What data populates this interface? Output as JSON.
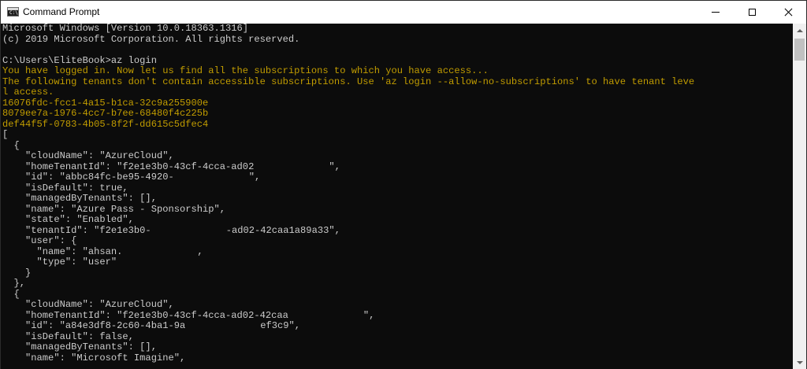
{
  "window": {
    "title": "Command Prompt",
    "icon": "cmd-prompt-icon",
    "controls": {
      "minimize": "minimize-icon",
      "maximize": "maximize-icon",
      "close": "close-icon"
    }
  },
  "colors": {
    "console_background": "#0c0c0c",
    "default_text": "#cccccc",
    "warning_text": "#c19c00"
  },
  "console": {
    "lines": [
      {
        "text": "Microsoft Windows [Version 10.0.18363.1316]",
        "color": "gray"
      },
      {
        "text": "(c) 2019 Microsoft Corporation. All rights reserved.",
        "color": "gray"
      },
      {
        "text": "",
        "color": "gray"
      },
      {
        "text": "C:\\Users\\EliteBook>az login",
        "color": "gray"
      },
      {
        "text": "You have logged in. Now let us find all the subscriptions to which you have access...",
        "color": "yellow"
      },
      {
        "text": "The following tenants don't contain accessible subscriptions. Use 'az login --allow-no-subscriptions' to have tenant leve",
        "color": "yellow"
      },
      {
        "text": "l access.",
        "color": "yellow"
      },
      {
        "text": "16076fdc-fcc1-4a15-b1ca-32c9a255900e",
        "color": "yellow"
      },
      {
        "text": "8079ee7a-1976-4cc7-b7ee-68480f4c225b",
        "color": "yellow"
      },
      {
        "text": "def44f5f-0783-4b05-8f2f-dd615c5dfec4",
        "color": "yellow"
      },
      {
        "text": "[",
        "color": "gray"
      },
      {
        "text": "  {",
        "color": "gray"
      },
      {
        "text": "    \"cloudName\": \"AzureCloud\",",
        "color": "gray"
      },
      {
        "text": "    \"homeTenantId\": \"f2e1e3b0-43cf-4cca-ad02",
        "suffix": "\",",
        "redacted": true,
        "color": "gray"
      },
      {
        "text": "    \"id\": \"abbc84fc-be95-4920-",
        "suffix": "\",",
        "redacted": true,
        "color": "gray"
      },
      {
        "text": "    \"isDefault\": true,",
        "color": "gray"
      },
      {
        "text": "    \"managedByTenants\": [],",
        "color": "gray"
      },
      {
        "text": "    \"name\": \"Azure Pass - Sponsorship\",",
        "color": "gray"
      },
      {
        "text": "    \"state\": \"Enabled\",",
        "color": "gray"
      },
      {
        "text": "    \"tenantId\": \"f2e1e3b0-",
        "suffix": "-ad02-42caa1a89a33\",",
        "redacted": true,
        "color": "gray"
      },
      {
        "text": "    \"user\": {",
        "color": "gray"
      },
      {
        "text": "      \"name\": \"ahsan.",
        "suffix": ",",
        "redacted": true,
        "color": "gray"
      },
      {
        "text": "      \"type\": \"user\"",
        "color": "gray"
      },
      {
        "text": "    }",
        "color": "gray"
      },
      {
        "text": "  },",
        "color": "gray"
      },
      {
        "text": "  {",
        "color": "gray"
      },
      {
        "text": "    \"cloudName\": \"AzureCloud\",",
        "color": "gray"
      },
      {
        "text": "    \"homeTenantId\": \"f2e1e3b0-43cf-4cca-ad02-42caa",
        "suffix": "\",",
        "redacted": true,
        "color": "gray"
      },
      {
        "text": "    \"id\": \"a84e3df8-2c60-4ba1-9a",
        "suffix": "ef3c9\",",
        "redacted": true,
        "color": "gray"
      },
      {
        "text": "    \"isDefault\": false,",
        "color": "gray"
      },
      {
        "text": "    \"managedByTenants\": [],",
        "color": "gray"
      },
      {
        "text": "    \"name\": \"Microsoft Imagine\",",
        "color": "gray"
      }
    ]
  },
  "scrollbar": {
    "up_icon": "scroll-up-arrow-icon",
    "down_icon": "scroll-down-arrow-icon"
  }
}
